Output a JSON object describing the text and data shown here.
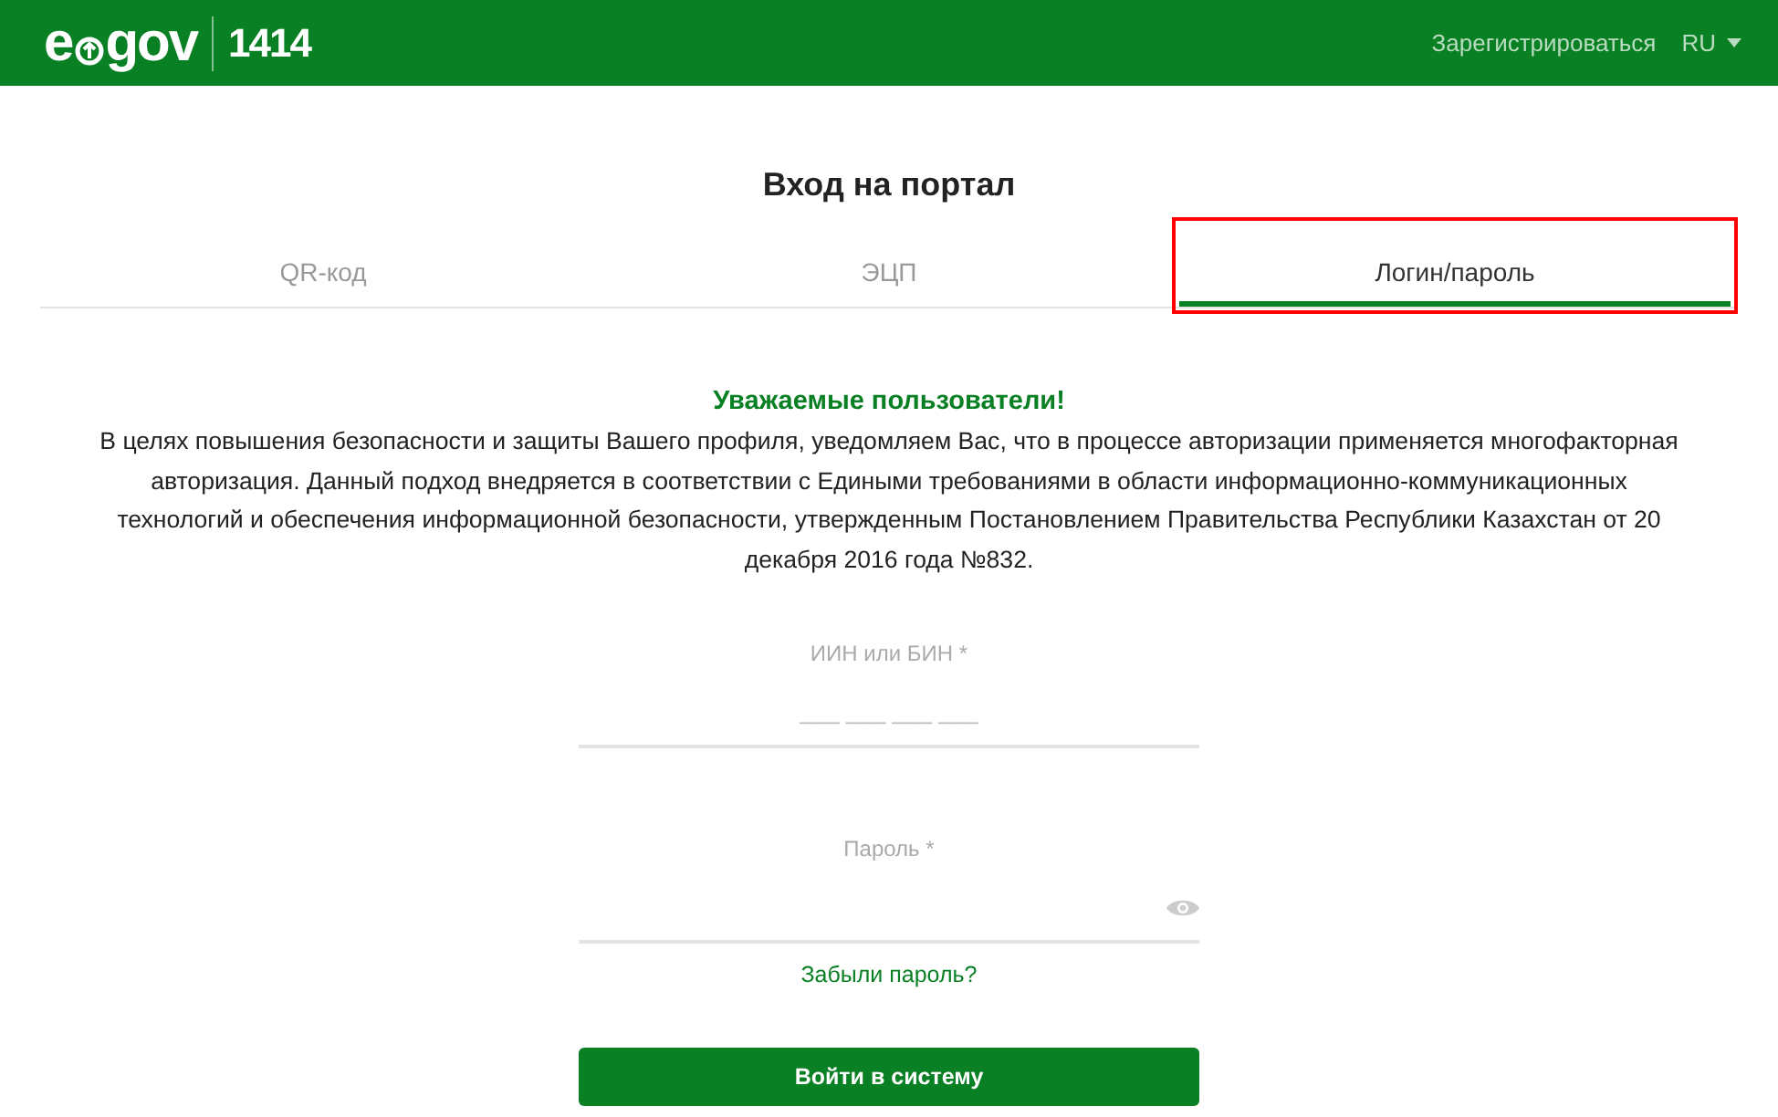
{
  "header": {
    "logo": {
      "prefix": "e",
      "suffix": "gov",
      "number": "1414"
    },
    "register_link": "Зарегистрироваться",
    "language": "RU"
  },
  "title": "Вход на портал",
  "tabs": [
    {
      "label": "QR-код",
      "selected": false,
      "highlighted": false
    },
    {
      "label": "ЭЦП",
      "selected": false,
      "highlighted": false
    },
    {
      "label": "Логин/пароль",
      "selected": true,
      "highlighted": true
    }
  ],
  "notice": {
    "heading": "Уважаемые пользователи!",
    "text": "В целях повышения безопасности и защиты Вашего профиля, уведомляем Вас, что в процессе авторизации применяется многофакторная авторизация. Данный подход внедряется в соответствии с Едиными требованиями в области информационно-коммуникационных технологий и обеспечения информационной безопасности, утвержденным Постановлением Правительства Республики Казахстан от 20 декабря 2016 года №832."
  },
  "form": {
    "fields": [
      {
        "kind": "text",
        "label": "ИИН или БИН *",
        "placeholder": "___ ___ ___ ___"
      },
      {
        "kind": "password",
        "label": "Пароль *"
      }
    ],
    "forgot_link": "Забыли пароль?",
    "submit": "Войти в систему"
  }
}
